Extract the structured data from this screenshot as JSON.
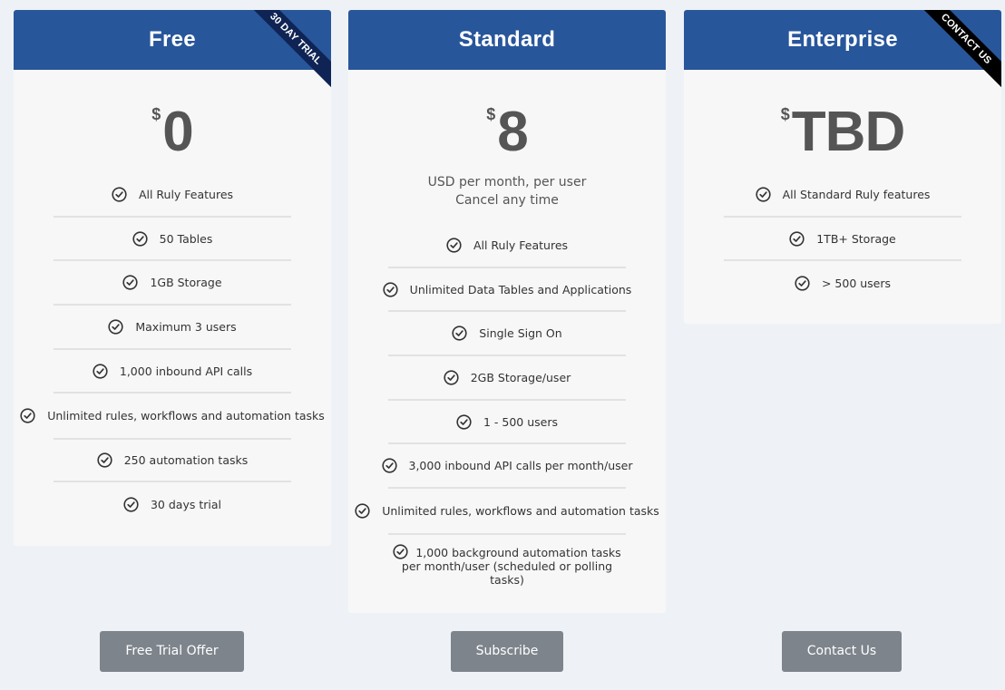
{
  "plans": [
    {
      "name": "Free",
      "ribbon": "30 DAY TRIAL",
      "currency": "$",
      "amount": "0",
      "note": [],
      "features": [
        "All Ruly Features",
        "50 Tables",
        "1GB Storage",
        "Maximum 3 users",
        "1,000 inbound API calls",
        "Unlimited rules, workflows and automation tasks",
        "250 automation tasks",
        "30 days trial"
      ],
      "cta": "Free Trial Offer"
    },
    {
      "name": "Standard",
      "ribbon": "",
      "currency": "$",
      "amount": "8",
      "note": [
        "USD per month, per user",
        "Cancel any time"
      ],
      "features": [
        "All Ruly Features",
        "Unlimited Data Tables and Applications",
        "Single Sign On",
        "2GB Storage/user",
        "1 - 500 users",
        "3,000 inbound API calls per month/user",
        "Unlimited rules, workflows and automation tasks",
        "1,000 background automation tasks per month/user (scheduled or polling tasks)"
      ],
      "cta": "Subscribe"
    },
    {
      "name": "Enterprise",
      "ribbon": "CONTACT US",
      "currency": "$",
      "amount": "TBD",
      "note": [],
      "features": [
        "All Standard Ruly features",
        "1TB+ Storage",
        "> 500 users"
      ],
      "cta": "Contact Us"
    }
  ],
  "icons": {
    "feature": "check-circle-icon"
  },
  "colors": {
    "header": "#28569b",
    "ribbon_trial": "#0f2454",
    "ribbon_contact": "#000000",
    "button": "#7d848c",
    "page_bg": "#eef2f7",
    "card_bg": "#f7f7f7"
  }
}
